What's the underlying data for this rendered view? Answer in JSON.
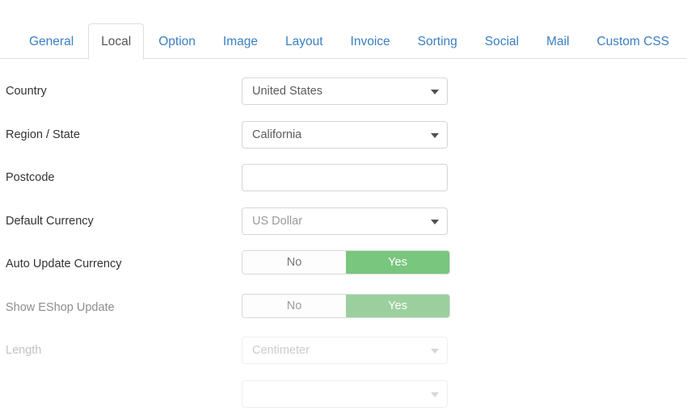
{
  "tabs": [
    {
      "label": "General",
      "active": false
    },
    {
      "label": "Local",
      "active": true
    },
    {
      "label": "Option",
      "active": false
    },
    {
      "label": "Image",
      "active": false
    },
    {
      "label": "Layout",
      "active": false
    },
    {
      "label": "Invoice",
      "active": false
    },
    {
      "label": "Sorting",
      "active": false
    },
    {
      "label": "Social",
      "active": false
    },
    {
      "label": "Mail",
      "active": false
    },
    {
      "label": "Custom CSS",
      "active": false
    }
  ],
  "form": {
    "country": {
      "label": "Country",
      "value": "United States"
    },
    "region": {
      "label": "Region / State",
      "value": "California"
    },
    "postcode": {
      "label": "Postcode",
      "value": "",
      "placeholder": ""
    },
    "default_currency": {
      "label": "Default Currency",
      "value": "US Dollar"
    },
    "auto_update_currency": {
      "label": "Auto Update Currency",
      "off_label": "No",
      "on_label": "Yes",
      "selected": "Yes"
    },
    "show_eshop_update": {
      "label": "Show EShop Update",
      "off_label": "No",
      "on_label": "Yes",
      "selected": "Yes"
    },
    "length": {
      "label": "Length",
      "value": "Centimeter"
    },
    "next_partial": {
      "label": "",
      "value": ""
    }
  },
  "colors": {
    "tab_link": "#3a7fc1",
    "tab_active_text": "#555555",
    "toggle_on": "#79c67e",
    "toggle_on_faded": "#9bd09e",
    "border": "#dddddd",
    "text": "#333333",
    "muted_text": "#8d8d8d",
    "disabled_text": "#c3c3c3"
  }
}
